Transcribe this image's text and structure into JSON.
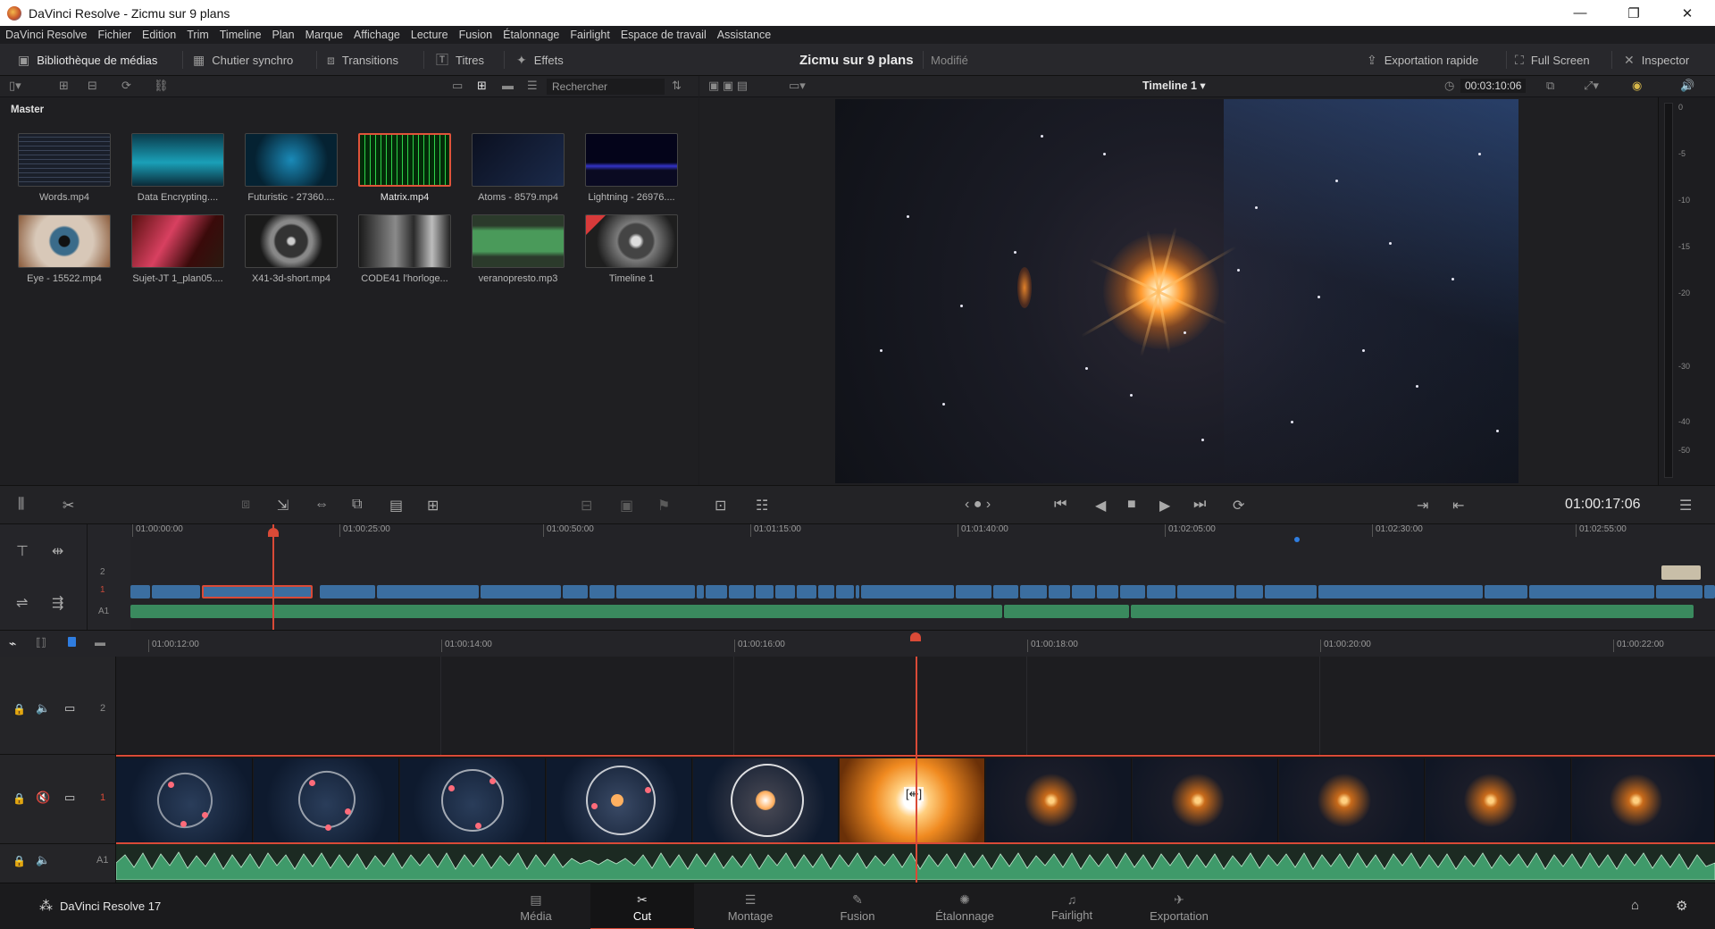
{
  "window": {
    "title": "DaVinci Resolve - Zicmu sur 9 plans"
  },
  "menu": [
    "DaVinci Resolve",
    "Fichier",
    "Edition",
    "Trim",
    "Timeline",
    "Plan",
    "Marque",
    "Affichage",
    "Lecture",
    "Fusion",
    "Étalonnage",
    "Fairlight",
    "Espace de travail",
    "Assistance"
  ],
  "toolbar": {
    "media_library": "Bibliothèque de médias",
    "sync_bin": "Chutier synchro",
    "transitions": "Transitions",
    "titles": "Titres",
    "effects": "Effets",
    "project_name": "Zicmu sur 9 plans",
    "project_status": "Modifié",
    "quick_export": "Exportation rapide",
    "full_screen": "Full Screen",
    "inspector": "Inspector"
  },
  "media_pool": {
    "search_placeholder": "Rechercher",
    "bin": "Master",
    "clips": [
      {
        "name": "Words.mp4"
      },
      {
        "name": "Data Encrypting...."
      },
      {
        "name": "Futuristic - 27360...."
      },
      {
        "name": "Matrix.mp4",
        "selected": true
      },
      {
        "name": "Atoms - 8579.mp4"
      },
      {
        "name": "Lightning - 26976...."
      },
      {
        "name": "Eye - 15522.mp4"
      },
      {
        "name": "Sujet-JT 1_plan05...."
      },
      {
        "name": "X41-3d-short.mp4"
      },
      {
        "name": "CODE41 l'horloge..."
      },
      {
        "name": "veranopresto.mp3"
      },
      {
        "name": "Timeline 1"
      }
    ]
  },
  "viewer": {
    "timeline_name": "Timeline 1",
    "duration": "00:03:10:06",
    "timecode": "01:00:17:06"
  },
  "meter_ticks": [
    "0",
    "-5",
    "-10",
    "-15",
    "-20",
    "-30",
    "-40",
    "-50"
  ],
  "upper_ruler": [
    "01:00:00:00",
    "01:00:25:00",
    "01:00:50:00",
    "01:01:15:00",
    "01:01:40:00",
    "01:02:05:00",
    "01:02:30:00",
    "01:02:55:00"
  ],
  "upper_tracks": [
    "2",
    "1",
    "A1"
  ],
  "lower_ruler": [
    "01:00:12:00",
    "01:00:14:00",
    "01:00:16:00",
    "01:00:18:00",
    "01:00:20:00",
    "01:00:22:00"
  ],
  "lower_tracks": [
    "2",
    "1",
    "A1"
  ],
  "pages": [
    {
      "label": "Média"
    },
    {
      "label": "Cut",
      "active": true
    },
    {
      "label": "Montage"
    },
    {
      "label": "Fusion"
    },
    {
      "label": "Étalonnage"
    },
    {
      "label": "Fairlight"
    },
    {
      "label": "Exportation"
    }
  ],
  "product": "DaVinci Resolve 17"
}
